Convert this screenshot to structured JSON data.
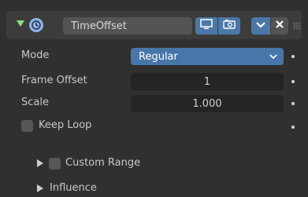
{
  "header": {
    "modifier_name": "TimeOffset",
    "icons": {
      "collapse": "collapse-triangle-icon",
      "modifier": "timeoffset-modifier-icon",
      "display": "monitor-icon",
      "render": "camera-icon",
      "expand": "chevron-down-icon",
      "close": "close-icon",
      "drag": "drag-grip-icon"
    }
  },
  "properties": {
    "mode": {
      "label": "Mode",
      "value": "Regular"
    },
    "frame_offset": {
      "label": "Frame Offset",
      "value": "1"
    },
    "scale": {
      "label": "Scale",
      "value": "1.000"
    },
    "keep_loop": {
      "label": "Keep Loop",
      "checked": false
    }
  },
  "subpanels": {
    "custom_range": {
      "label": "Custom Range",
      "checked": false
    },
    "influence": {
      "label": "Influence"
    }
  },
  "colors": {
    "accent": "#4876a8",
    "collapse_arrow": "#8be07f",
    "panel_bg": "#303030"
  }
}
